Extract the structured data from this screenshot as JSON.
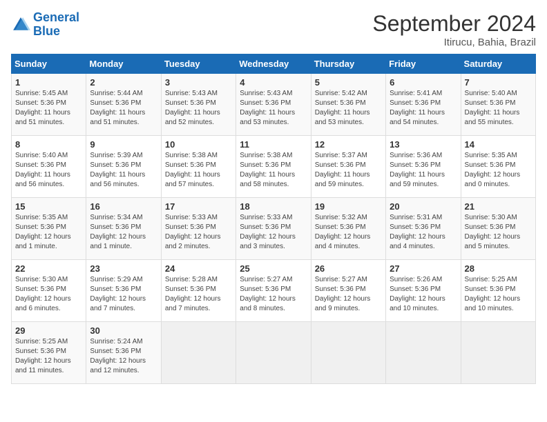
{
  "header": {
    "logo_line1": "General",
    "logo_line2": "Blue",
    "month": "September 2024",
    "location": "Itirucu, Bahia, Brazil"
  },
  "weekdays": [
    "Sunday",
    "Monday",
    "Tuesday",
    "Wednesday",
    "Thursday",
    "Friday",
    "Saturday"
  ],
  "weeks": [
    [
      {
        "day": "1",
        "info": "Sunrise: 5:45 AM\nSunset: 5:36 PM\nDaylight: 11 hours\nand 51 minutes."
      },
      {
        "day": "2",
        "info": "Sunrise: 5:44 AM\nSunset: 5:36 PM\nDaylight: 11 hours\nand 51 minutes."
      },
      {
        "day": "3",
        "info": "Sunrise: 5:43 AM\nSunset: 5:36 PM\nDaylight: 11 hours\nand 52 minutes."
      },
      {
        "day": "4",
        "info": "Sunrise: 5:43 AM\nSunset: 5:36 PM\nDaylight: 11 hours\nand 53 minutes."
      },
      {
        "day": "5",
        "info": "Sunrise: 5:42 AM\nSunset: 5:36 PM\nDaylight: 11 hours\nand 53 minutes."
      },
      {
        "day": "6",
        "info": "Sunrise: 5:41 AM\nSunset: 5:36 PM\nDaylight: 11 hours\nand 54 minutes."
      },
      {
        "day": "7",
        "info": "Sunrise: 5:40 AM\nSunset: 5:36 PM\nDaylight: 11 hours\nand 55 minutes."
      }
    ],
    [
      {
        "day": "8",
        "info": "Sunrise: 5:40 AM\nSunset: 5:36 PM\nDaylight: 11 hours\nand 56 minutes."
      },
      {
        "day": "9",
        "info": "Sunrise: 5:39 AM\nSunset: 5:36 PM\nDaylight: 11 hours\nand 56 minutes."
      },
      {
        "day": "10",
        "info": "Sunrise: 5:38 AM\nSunset: 5:36 PM\nDaylight: 11 hours\nand 57 minutes."
      },
      {
        "day": "11",
        "info": "Sunrise: 5:38 AM\nSunset: 5:36 PM\nDaylight: 11 hours\nand 58 minutes."
      },
      {
        "day": "12",
        "info": "Sunrise: 5:37 AM\nSunset: 5:36 PM\nDaylight: 11 hours\nand 59 minutes."
      },
      {
        "day": "13",
        "info": "Sunrise: 5:36 AM\nSunset: 5:36 PM\nDaylight: 11 hours\nand 59 minutes."
      },
      {
        "day": "14",
        "info": "Sunrise: 5:35 AM\nSunset: 5:36 PM\nDaylight: 12 hours\nand 0 minutes."
      }
    ],
    [
      {
        "day": "15",
        "info": "Sunrise: 5:35 AM\nSunset: 5:36 PM\nDaylight: 12 hours\nand 1 minute."
      },
      {
        "day": "16",
        "info": "Sunrise: 5:34 AM\nSunset: 5:36 PM\nDaylight: 12 hours\nand 1 minute."
      },
      {
        "day": "17",
        "info": "Sunrise: 5:33 AM\nSunset: 5:36 PM\nDaylight: 12 hours\nand 2 minutes."
      },
      {
        "day": "18",
        "info": "Sunrise: 5:33 AM\nSunset: 5:36 PM\nDaylight: 12 hours\nand 3 minutes."
      },
      {
        "day": "19",
        "info": "Sunrise: 5:32 AM\nSunset: 5:36 PM\nDaylight: 12 hours\nand 4 minutes."
      },
      {
        "day": "20",
        "info": "Sunrise: 5:31 AM\nSunset: 5:36 PM\nDaylight: 12 hours\nand 4 minutes."
      },
      {
        "day": "21",
        "info": "Sunrise: 5:30 AM\nSunset: 5:36 PM\nDaylight: 12 hours\nand 5 minutes."
      }
    ],
    [
      {
        "day": "22",
        "info": "Sunrise: 5:30 AM\nSunset: 5:36 PM\nDaylight: 12 hours\nand 6 minutes."
      },
      {
        "day": "23",
        "info": "Sunrise: 5:29 AM\nSunset: 5:36 PM\nDaylight: 12 hours\nand 7 minutes."
      },
      {
        "day": "24",
        "info": "Sunrise: 5:28 AM\nSunset: 5:36 PM\nDaylight: 12 hours\nand 7 minutes."
      },
      {
        "day": "25",
        "info": "Sunrise: 5:27 AM\nSunset: 5:36 PM\nDaylight: 12 hours\nand 8 minutes."
      },
      {
        "day": "26",
        "info": "Sunrise: 5:27 AM\nSunset: 5:36 PM\nDaylight: 12 hours\nand 9 minutes."
      },
      {
        "day": "27",
        "info": "Sunrise: 5:26 AM\nSunset: 5:36 PM\nDaylight: 12 hours\nand 10 minutes."
      },
      {
        "day": "28",
        "info": "Sunrise: 5:25 AM\nSunset: 5:36 PM\nDaylight: 12 hours\nand 10 minutes."
      }
    ],
    [
      {
        "day": "29",
        "info": "Sunrise: 5:25 AM\nSunset: 5:36 PM\nDaylight: 12 hours\nand 11 minutes."
      },
      {
        "day": "30",
        "info": "Sunrise: 5:24 AM\nSunset: 5:36 PM\nDaylight: 12 hours\nand 12 minutes."
      },
      {
        "day": "",
        "info": ""
      },
      {
        "day": "",
        "info": ""
      },
      {
        "day": "",
        "info": ""
      },
      {
        "day": "",
        "info": ""
      },
      {
        "day": "",
        "info": ""
      }
    ]
  ]
}
